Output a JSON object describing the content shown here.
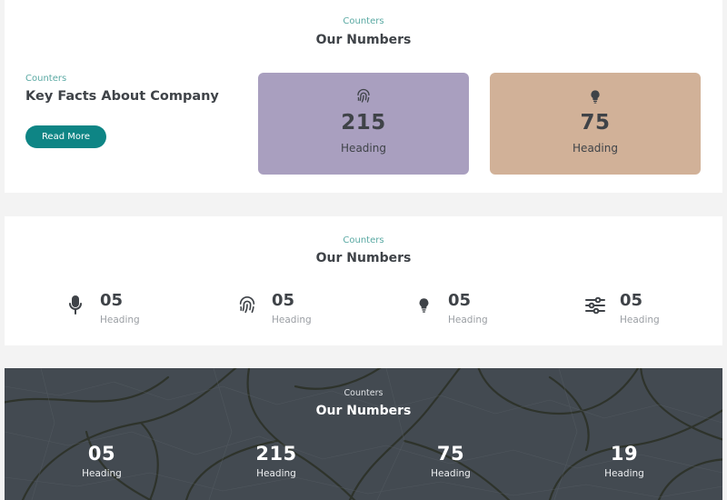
{
  "section1": {
    "eyebrow": "Counters",
    "title": "Our Numbers",
    "intro": {
      "eyebrow": "Counters",
      "title": "Key Facts About Company",
      "button_label": "Read More"
    },
    "cards": [
      {
        "icon": "fingerprint-icon",
        "value": "215",
        "label": "Heading",
        "color": "#a99fbf"
      },
      {
        "icon": "lightbulb-icon",
        "value": "75",
        "label": "Heading",
        "color": "#d1b198"
      }
    ]
  },
  "section2": {
    "eyebrow": "Counters",
    "title": "Our Numbers",
    "counters": [
      {
        "icon": "microphone-icon",
        "value": "05",
        "label": "Heading"
      },
      {
        "icon": "fingerprint-icon",
        "value": "05",
        "label": "Heading"
      },
      {
        "icon": "lightbulb-icon",
        "value": "05",
        "label": "Heading"
      },
      {
        "icon": "sliders-icon",
        "value": "05",
        "label": "Heading"
      }
    ]
  },
  "section3": {
    "eyebrow": "Counters",
    "title": "Our Numbers",
    "counters": [
      {
        "value": "05",
        "label": "Heading"
      },
      {
        "value": "215",
        "label": "Heading"
      },
      {
        "value": "75",
        "label": "Heading"
      },
      {
        "value": "19",
        "label": "Heading"
      }
    ]
  },
  "colors": {
    "accent": "#0e8585",
    "eyebrow": "#5aa9a3",
    "heading": "#3f4348",
    "dark_background": "#434a51",
    "page_background": "#f3f3f3"
  }
}
